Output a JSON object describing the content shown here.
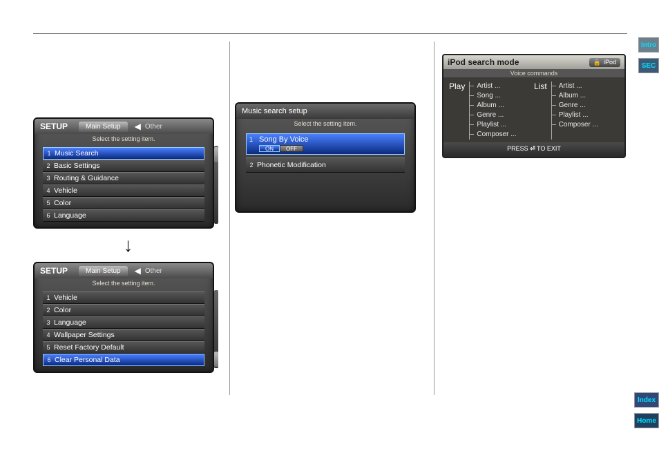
{
  "nav": {
    "intro": "Intro",
    "sec": "SEC",
    "index": "Index",
    "home": "Home"
  },
  "setup1": {
    "title": "SETUP",
    "tab_main": "Main Setup",
    "tab_other": "Other",
    "subtitle": "Select the setting item.",
    "items": [
      {
        "n": "1",
        "label": "Music Search"
      },
      {
        "n": "2",
        "label": "Basic Settings"
      },
      {
        "n": "3",
        "label": "Routing & Guidance"
      },
      {
        "n": "4",
        "label": "Vehicle"
      },
      {
        "n": "5",
        "label": "Color"
      },
      {
        "n": "6",
        "label": "Language"
      }
    ],
    "selected_index": 0
  },
  "setup2": {
    "title": "SETUP",
    "tab_main": "Main Setup",
    "tab_other": "Other",
    "subtitle": "Select the setting item.",
    "items": [
      {
        "n": "1",
        "label": "Vehicle"
      },
      {
        "n": "2",
        "label": "Color"
      },
      {
        "n": "3",
        "label": "Language"
      },
      {
        "n": "4",
        "label": "Wallpaper Settings"
      },
      {
        "n": "5",
        "label": "Reset Factory Default"
      },
      {
        "n": "6",
        "label": "Clear Personal Data"
      }
    ],
    "selected_index": 5
  },
  "music_setup": {
    "title": "Music search setup",
    "subtitle": "Select the setting item.",
    "row1": {
      "n": "1",
      "label": "Song By Voice",
      "on": "ON",
      "off": "OFF"
    },
    "row2": {
      "n": "2",
      "label": "Phonetic Modification"
    }
  },
  "ipod": {
    "title": "iPod search mode",
    "badge": "iPod",
    "sub": "Voice commands",
    "play_head": "Play",
    "list_head": "List",
    "play_items": [
      "Artist ...",
      "Song ...",
      "Album ...",
      "Genre ...",
      "Playlist ...",
      "Composer ..."
    ],
    "list_items": [
      "Artist ...",
      "Album ...",
      "Genre ...",
      "Playlist ...",
      "Composer ..."
    ],
    "footer_pre": "PRESS ",
    "footer_icon": "⏎",
    "footer_post": " TO EXIT"
  }
}
